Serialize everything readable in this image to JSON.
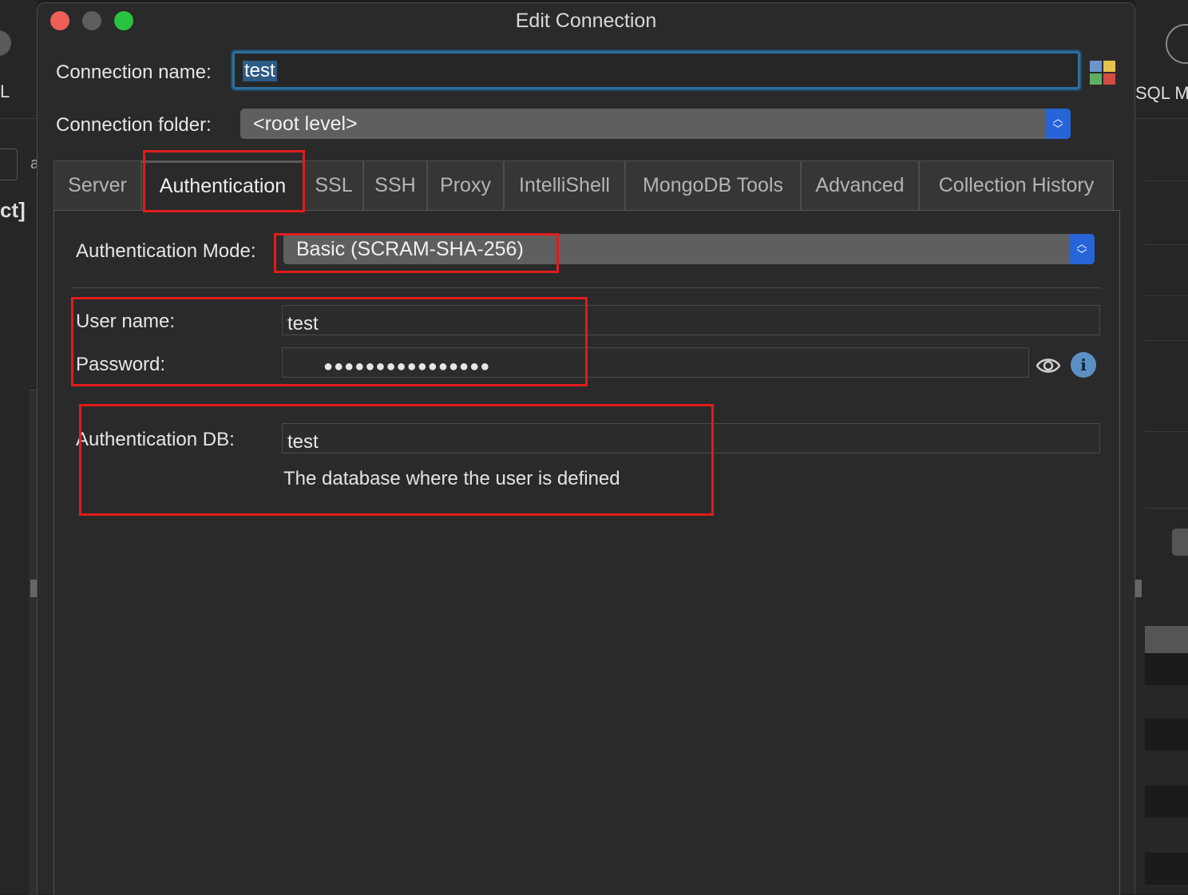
{
  "background": {
    "left_fragment_text": "L",
    "left_fragment_text2": "a",
    "left_fragment_bracket": "ct]",
    "right_fragment_text": "SQL Mi"
  },
  "dialog": {
    "title": "Edit Connection",
    "connection_name_label": "Connection name:",
    "connection_name_value": "test",
    "connection_folder_label": "Connection folder:",
    "connection_folder_value": "<root level>",
    "tabs": [
      {
        "label": "Server",
        "active": false
      },
      {
        "label": "Authentication",
        "active": true
      },
      {
        "label": "SSL",
        "active": false
      },
      {
        "label": "SSH",
        "active": false
      },
      {
        "label": "Proxy",
        "active": false
      },
      {
        "label": "IntelliShell",
        "active": false
      },
      {
        "label": "MongoDB Tools",
        "active": false
      },
      {
        "label": "Advanced",
        "active": false
      },
      {
        "label": "Collection History",
        "active": false
      }
    ],
    "auth": {
      "mode_label": "Authentication Mode:",
      "mode_value": "Basic (SCRAM-SHA-256)",
      "username_label": "User name:",
      "username_value": "test",
      "password_label": "Password:",
      "password_mask": "●●●●●●●●●●●●●●●●",
      "auth_db_label": "Authentication DB:",
      "auth_db_value": "test",
      "auth_db_hint": "The database where the user is defined"
    }
  },
  "colors": {
    "annotation": "#e01c1c",
    "select_accent": "#2764d8",
    "focus_ring": "#2f6f9d"
  },
  "icons": [
    "close-light",
    "minimize-light",
    "zoom-light",
    "color-picker-icon",
    "eye-icon",
    "info-icon",
    "database-icon",
    "updown-arrows-icon"
  ]
}
